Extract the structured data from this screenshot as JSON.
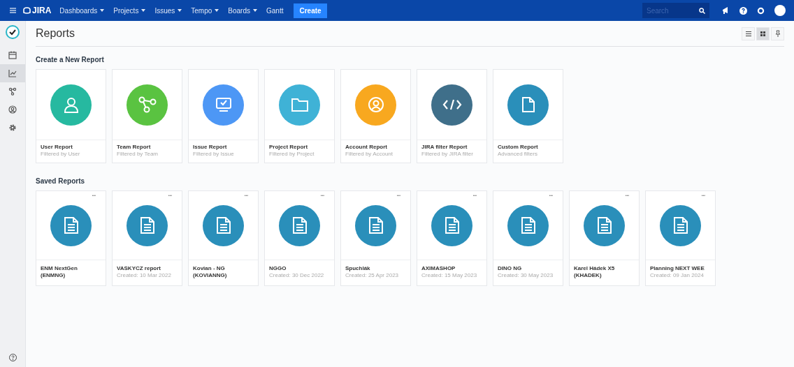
{
  "topbar": {
    "logo": "JIRA",
    "menu": [
      {
        "label": "Dashboards",
        "dropdown": true
      },
      {
        "label": "Projects",
        "dropdown": true
      },
      {
        "label": "Issues",
        "dropdown": true
      },
      {
        "label": "Tempo",
        "dropdown": true
      },
      {
        "label": "Boards",
        "dropdown": true
      },
      {
        "label": "Gantt",
        "dropdown": false
      }
    ],
    "create_button": "Create",
    "search": {
      "placeholder": "Search"
    }
  },
  "sidebar": {
    "items": [
      {
        "kind": "calendar",
        "selected": false
      },
      {
        "kind": "chart",
        "selected": true
      },
      {
        "kind": "team",
        "selected": false
      },
      {
        "kind": "account",
        "selected": false
      },
      {
        "kind": "settings",
        "selected": false
      }
    ]
  },
  "page": {
    "title": "Reports",
    "views": [
      {
        "kind": "list",
        "selected": false
      },
      {
        "kind": "grid",
        "selected": true
      },
      {
        "kind": "pin",
        "selected": false
      }
    ]
  },
  "create_section": {
    "title": "Create a New Report",
    "reports": [
      {
        "kind": "user",
        "color": "#26b9a0",
        "name": "User Report",
        "subtitle": "Filtered by User"
      },
      {
        "kind": "team",
        "color": "#5ac341",
        "name": "Team Report",
        "subtitle": "Filtered by Team"
      },
      {
        "kind": "issue",
        "color": "#4d97f5",
        "name": "Issue Report",
        "subtitle": "Filtered by Issue"
      },
      {
        "kind": "project",
        "color": "#3fb2d6",
        "name": "Project Report",
        "subtitle": "Filtered by Project"
      },
      {
        "kind": "account",
        "color": "#f8a81f",
        "name": "Account Report",
        "subtitle": "Filtered by Account"
      },
      {
        "kind": "code",
        "color": "#3f6f8a",
        "name": "JIRA filter Report",
        "subtitle": "Filtered by JIRA filter"
      },
      {
        "kind": "custom",
        "color": "#2a8fba",
        "name": "Custom Report",
        "subtitle": "Advanced filters"
      }
    ]
  },
  "saved_section": {
    "title": "Saved Reports",
    "more": "•••",
    "reports": [
      {
        "name": "ENM NextGen (ENMNG)"
      },
      {
        "name": "VASKYCZ report",
        "subtitle": "Created: 10 Mar 2022"
      },
      {
        "name": "Kovian - NG (KOVIANNG)"
      },
      {
        "name": "NGGO",
        "subtitle": "Created: 30 Dec 2022"
      },
      {
        "name": "Spuchlák",
        "subtitle": "Created: 25 Apr 2023"
      },
      {
        "name": "AXIMASHOP",
        "subtitle": "Created: 15 May 2023"
      },
      {
        "name": "DINO NG",
        "subtitle": "Created: 30 May 2023"
      },
      {
        "name": "Karel Hádek X5 (KHADEK)"
      },
      {
        "name": "Planning NEXT WEE",
        "subtitle": "Created: 09 Jan 2024"
      }
    ]
  }
}
